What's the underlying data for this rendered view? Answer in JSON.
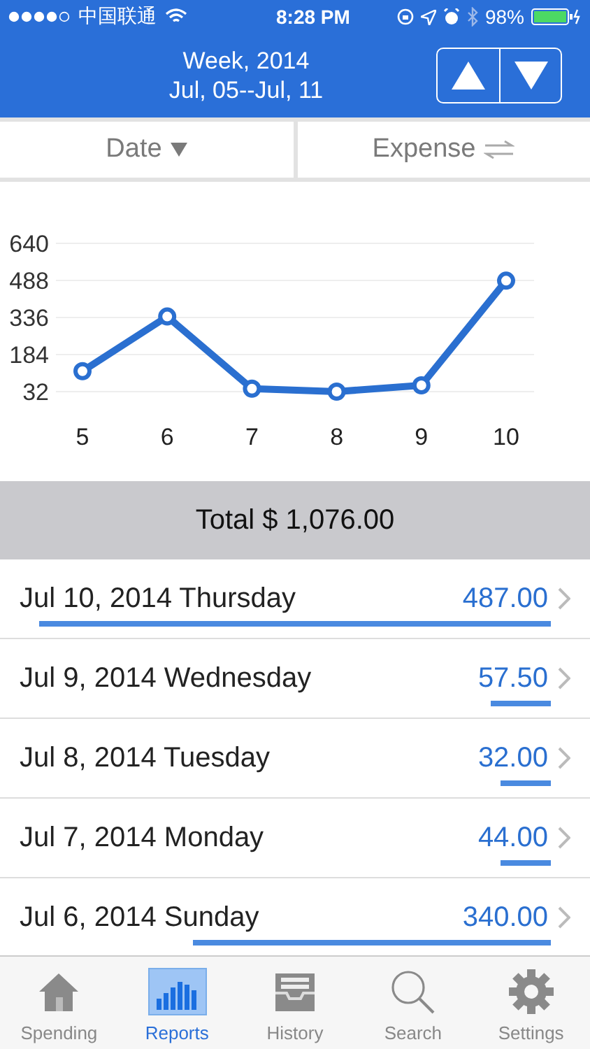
{
  "status_bar": {
    "carrier": "中国联通",
    "time": "8:28 PM",
    "battery": "98%"
  },
  "header": {
    "title": "Week, 2014",
    "range": "Jul, 05--Jul, 11"
  },
  "sort_bar": [
    {
      "label": "Date",
      "kind": "caret"
    },
    {
      "label": "Expense",
      "kind": "swap"
    }
  ],
  "chart_data": {
    "type": "line",
    "x": [
      "5",
      "6",
      "7",
      "8",
      "9",
      "10"
    ],
    "series": [
      {
        "color": "#2a6fd0",
        "marker": "circle",
        "values": [
          116,
          340,
          44,
          32,
          58,
          487
        ]
      }
    ],
    "ylim": [
      32,
      640
    ],
    "yticks": [
      32,
      184,
      336,
      488,
      640
    ],
    "grid": true
  },
  "total": "Total $ 1,076.00",
  "days": [
    {
      "label": "Jul 10, 2014 Thursday",
      "amount": "487.00"
    },
    {
      "label": "Jul 9, 2014 Wednesday",
      "amount": "57.50"
    },
    {
      "label": "Jul 8, 2014 Tuesday",
      "amount": "32.00"
    },
    {
      "label": "Jul 7, 2014 Monday",
      "amount": "44.00"
    },
    {
      "label": "Jul 6, 2014 Sunday",
      "amount": "340.00"
    }
  ],
  "tabs": [
    {
      "label": "Spending",
      "kind": "house",
      "selected": false
    },
    {
      "label": "Reports",
      "kind": "bars",
      "selected": true
    },
    {
      "label": "History",
      "kind": "tray",
      "selected": false
    },
    {
      "label": "Search",
      "kind": "search",
      "selected": false
    },
    {
      "label": "Settings",
      "kind": "gear",
      "selected": false
    }
  ]
}
